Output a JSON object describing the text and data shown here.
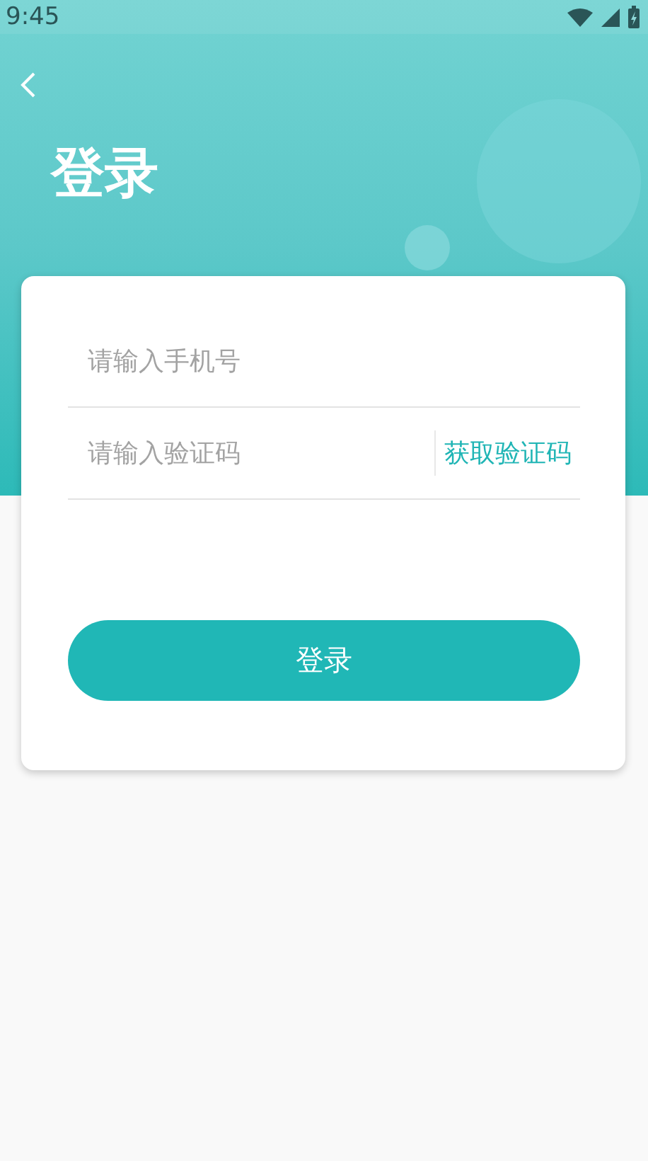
{
  "status_bar": {
    "time": "9:45"
  },
  "header": {
    "title": "登录"
  },
  "form": {
    "phone": {
      "placeholder": "请输入手机号"
    },
    "code": {
      "placeholder": "请输入验证码"
    },
    "get_code_link": "获取验证码",
    "submit_button": "登录"
  }
}
